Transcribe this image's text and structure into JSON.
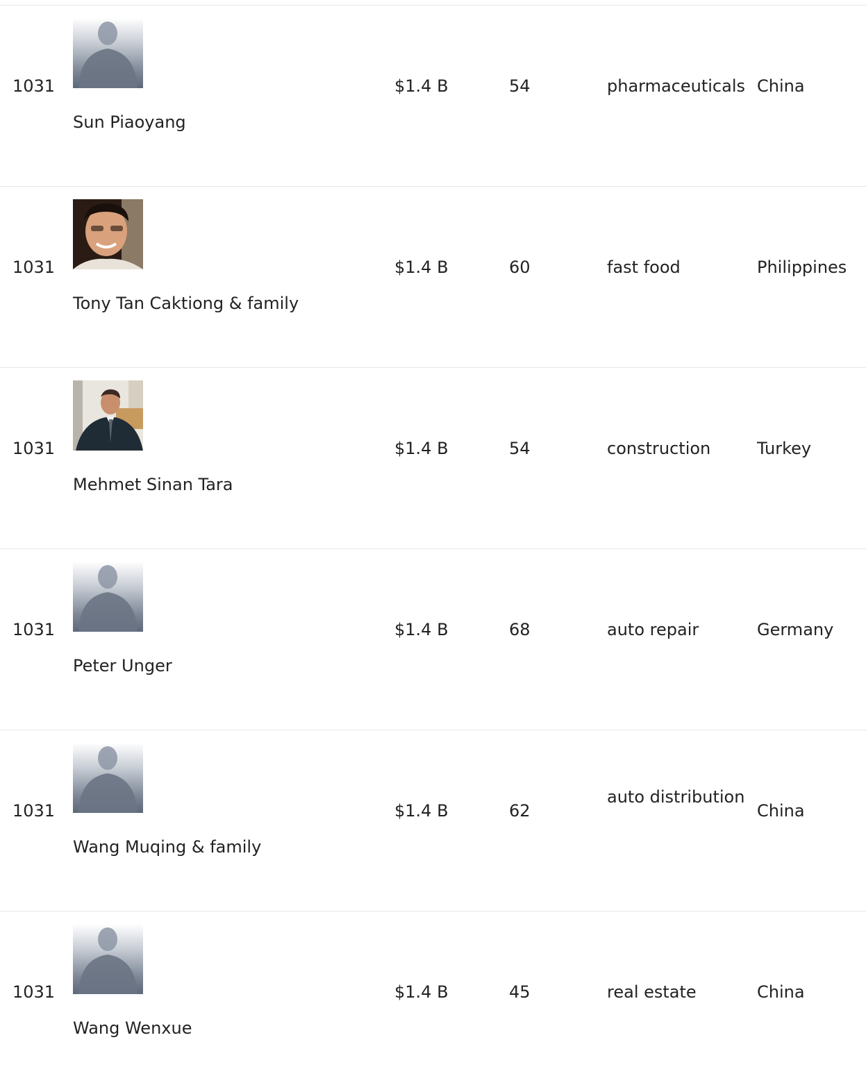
{
  "rows": [
    {
      "rank": "1031",
      "name": "Sun Piaoyang",
      "worth": "$1.4 B",
      "age": "54",
      "industry": "pharmaceuticals",
      "country": "China",
      "photo": "placeholder-avatar"
    },
    {
      "rank": "1031",
      "name": "Tony Tan Caktiong & family",
      "worth": "$1.4 B",
      "age": "60",
      "industry": "fast food",
      "country": "Philippines",
      "photo": "portrait-photo"
    },
    {
      "rank": "1031",
      "name": "Mehmet Sinan Tara",
      "worth": "$1.4 B",
      "age": "54",
      "industry": "construction",
      "country": "Turkey",
      "photo": "portrait-photo"
    },
    {
      "rank": "1031",
      "name": "Peter Unger",
      "worth": "$1.4 B",
      "age": "68",
      "industry": "auto repair",
      "country": "Germany",
      "photo": "placeholder-avatar"
    },
    {
      "rank": "1031",
      "name": "Wang Muqing & family",
      "worth": "$1.4 B",
      "age": "62",
      "industry": "auto distribution",
      "country": "China",
      "photo": "placeholder-avatar"
    },
    {
      "rank": "1031",
      "name": "Wang Wenxue",
      "worth": "$1.4 B",
      "age": "45",
      "industry": "real estate",
      "country": "China",
      "photo": "placeholder-avatar"
    }
  ],
  "colors": {
    "text": "#222222",
    "divider": "#e6e6e6",
    "placeholder_dark": "#5d6878",
    "placeholder_light": "#ffffff"
  }
}
